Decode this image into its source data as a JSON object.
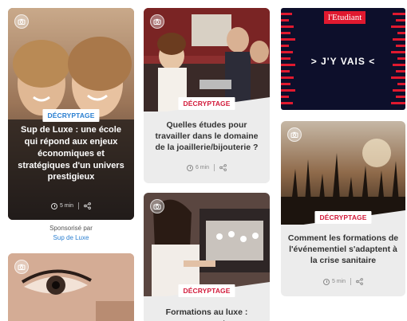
{
  "cards": {
    "sup_de_luxe": {
      "tag": "DÉCRYPTAGE",
      "title": "Sup de Luxe : une école qui répond aux enjeux économiques et stratégiques d'un univers prestigieux",
      "read_time": "5 min"
    },
    "joaillerie": {
      "tag": "DÉCRYPTAGE",
      "title": "Quelles études pour travailler dans le domaine de la joaillerie/bijouterie ?",
      "read_time": "6 min"
    },
    "etudiant_ad": {
      "logo": "l'Etudiant",
      "cta": "> J'Y VAIS <"
    },
    "evenementiel": {
      "tag": "DÉCRYPTAGE",
      "title": "Comment les formations de l'événementiel s'adaptent à la crise sanitaire",
      "read_time": "5 min"
    },
    "luxe": {
      "tag": "DÉCRYPTAGE",
      "title": "Formations au luxe : comment"
    }
  },
  "sponsor": {
    "prefix": "Sponsorisé par",
    "name": "Sup de Luxe"
  },
  "colors": {
    "tag_blue": "#2a7fd1",
    "tag_red": "#d21a3a",
    "ad_background": "#0d0f2b",
    "ad_accent": "#e0192f"
  },
  "icons": [
    "camera-icon",
    "clock-icon",
    "share-icon"
  ]
}
